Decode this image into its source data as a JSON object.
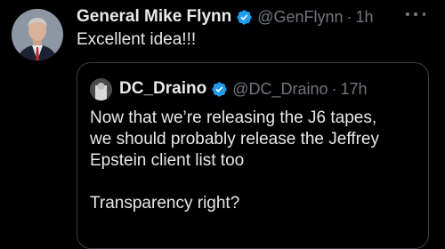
{
  "post": {
    "display_name": "General Mike Flynn",
    "handle": "@GenFlynn",
    "separator": "·",
    "time": "1h",
    "text": "Excellent idea!!!"
  },
  "quote": {
    "display_name": "DC_Draino",
    "handle": "@DC_Draino",
    "separator": "·",
    "time": "17h",
    "lines": [
      "Now that we’re releasing the J6 tapes,",
      "we should probably release the Jeffrey",
      "Epstein client list too"
    ],
    "last_line": "Transparency right?"
  },
  "colors": {
    "background": "#000000",
    "text": "#e7e9ea",
    "muted": "#71767b",
    "verified": "#1d9bf0",
    "border": "#3a3f45"
  },
  "icons": {
    "verified": "verified-badge-icon",
    "more": "more-options-icon"
  }
}
